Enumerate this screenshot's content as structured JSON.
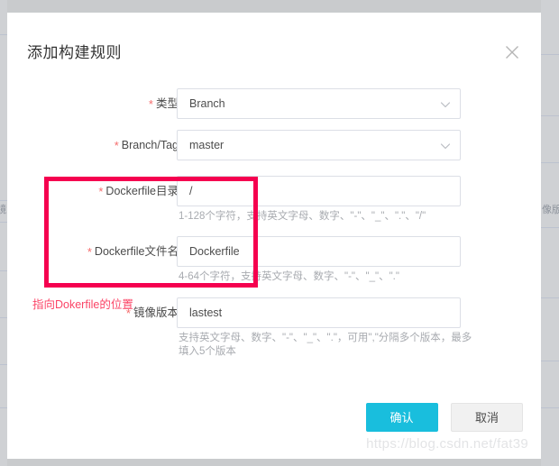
{
  "background": {
    "left_cell_text": "镜",
    "right_cell_text": "像版",
    "row_line_tops": [
      38,
      222,
      246,
      300,
      352,
      404,
      452
    ],
    "right_row_line_tops": [
      60,
      128,
      180,
      252,
      330,
      400,
      452
    ]
  },
  "modal": {
    "title": "添加构建规则",
    "close_icon": "close-icon",
    "fields": [
      {
        "label": "类型",
        "required": true,
        "type": "select",
        "value": "Branch",
        "hint": "",
        "icon": "chevron-down-icon"
      },
      {
        "label": "Branch/Tag",
        "required": true,
        "type": "select",
        "value": "master",
        "hint": "",
        "icon": "chevron-down-icon"
      },
      {
        "label": "Dockerfile目录",
        "required": true,
        "type": "input",
        "value": "/",
        "hint": "1-128个字符，支持英文字母、数字、\"-\"、\"_\"、\".\"、\"/\""
      },
      {
        "label": "Dockerfile文件名",
        "required": true,
        "type": "input",
        "value": "Dockerfile",
        "hint": "4-64个字符，支持英文字母、数字、\"-\"、\"_\"、\".\""
      },
      {
        "label": "镜像版本",
        "required": true,
        "type": "input",
        "value": "lastest",
        "hint": "支持英文字母、数字、\"-\"、\"_\"、\".\"，可用\",\"分隔多个版本，最多填入5个版本"
      }
    ],
    "footer": {
      "confirm_label": "确认",
      "cancel_label": "取消"
    }
  },
  "annotations": {
    "highlight_box_name": "dockerfile-location-highlight",
    "note_text": "指向Dokerfile的位置",
    "note_color": "#fb4466",
    "box_color": "#f5004f"
  },
  "watermark": {
    "text": "https://blog.csdn.net/fat39"
  },
  "colors": {
    "accent": "#19bedd",
    "required_star": "#f56c6c",
    "border": "#dcdfe6",
    "hint_text": "#a8abb0",
    "backdrop": "#c9cbcd"
  }
}
